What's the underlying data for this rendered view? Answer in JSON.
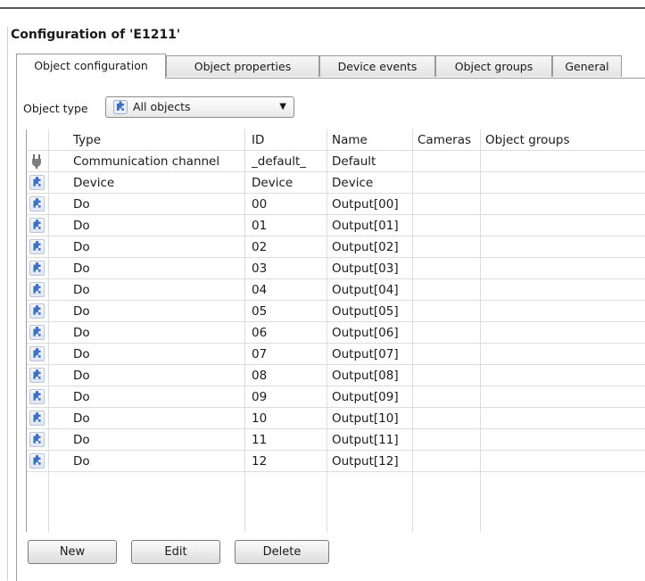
{
  "title": "Configuration of 'E1211'",
  "tabs": [
    {
      "label": "Object configuration",
      "active": true
    },
    {
      "label": "Object properties",
      "active": false
    },
    {
      "label": "Device events",
      "active": false
    },
    {
      "label": "Object groups",
      "active": false
    },
    {
      "label": "General",
      "active": false
    }
  ],
  "object_type": {
    "label": "Object type",
    "selected": "All objects",
    "icon": "puzzle-icon"
  },
  "table": {
    "columns": [
      "Type",
      "ID",
      "Name",
      "Cameras",
      "Object groups"
    ],
    "rows": [
      {
        "icon": "plug-icon",
        "type": "Communication channel",
        "id": "_default_",
        "name": "Default",
        "cameras": "",
        "groups": ""
      },
      {
        "icon": "puzzle-icon",
        "type": "Device",
        "id": "Device",
        "name": "Device",
        "cameras": "",
        "groups": ""
      },
      {
        "icon": "puzzle-icon",
        "type": "Do",
        "id": "00",
        "name": "Output[00]",
        "cameras": "",
        "groups": ""
      },
      {
        "icon": "puzzle-icon",
        "type": "Do",
        "id": "01",
        "name": "Output[01]",
        "cameras": "",
        "groups": ""
      },
      {
        "icon": "puzzle-icon",
        "type": "Do",
        "id": "02",
        "name": "Output[02]",
        "cameras": "",
        "groups": ""
      },
      {
        "icon": "puzzle-icon",
        "type": "Do",
        "id": "03",
        "name": "Output[03]",
        "cameras": "",
        "groups": ""
      },
      {
        "icon": "puzzle-icon",
        "type": "Do",
        "id": "04",
        "name": "Output[04]",
        "cameras": "",
        "groups": ""
      },
      {
        "icon": "puzzle-icon",
        "type": "Do",
        "id": "05",
        "name": "Output[05]",
        "cameras": "",
        "groups": ""
      },
      {
        "icon": "puzzle-icon",
        "type": "Do",
        "id": "06",
        "name": "Output[06]",
        "cameras": "",
        "groups": ""
      },
      {
        "icon": "puzzle-icon",
        "type": "Do",
        "id": "07",
        "name": "Output[07]",
        "cameras": "",
        "groups": ""
      },
      {
        "icon": "puzzle-icon",
        "type": "Do",
        "id": "08",
        "name": "Output[08]",
        "cameras": "",
        "groups": ""
      },
      {
        "icon": "puzzle-icon",
        "type": "Do",
        "id": "09",
        "name": "Output[09]",
        "cameras": "",
        "groups": ""
      },
      {
        "icon": "puzzle-icon",
        "type": "Do",
        "id": "10",
        "name": "Output[10]",
        "cameras": "",
        "groups": ""
      },
      {
        "icon": "puzzle-icon",
        "type": "Do",
        "id": "11",
        "name": "Output[11]",
        "cameras": "",
        "groups": ""
      },
      {
        "icon": "puzzle-icon",
        "type": "Do",
        "id": "12",
        "name": "Output[12]",
        "cameras": "",
        "groups": ""
      }
    ]
  },
  "buttons": {
    "new": "New",
    "edit": "Edit",
    "delete": "Delete"
  }
}
